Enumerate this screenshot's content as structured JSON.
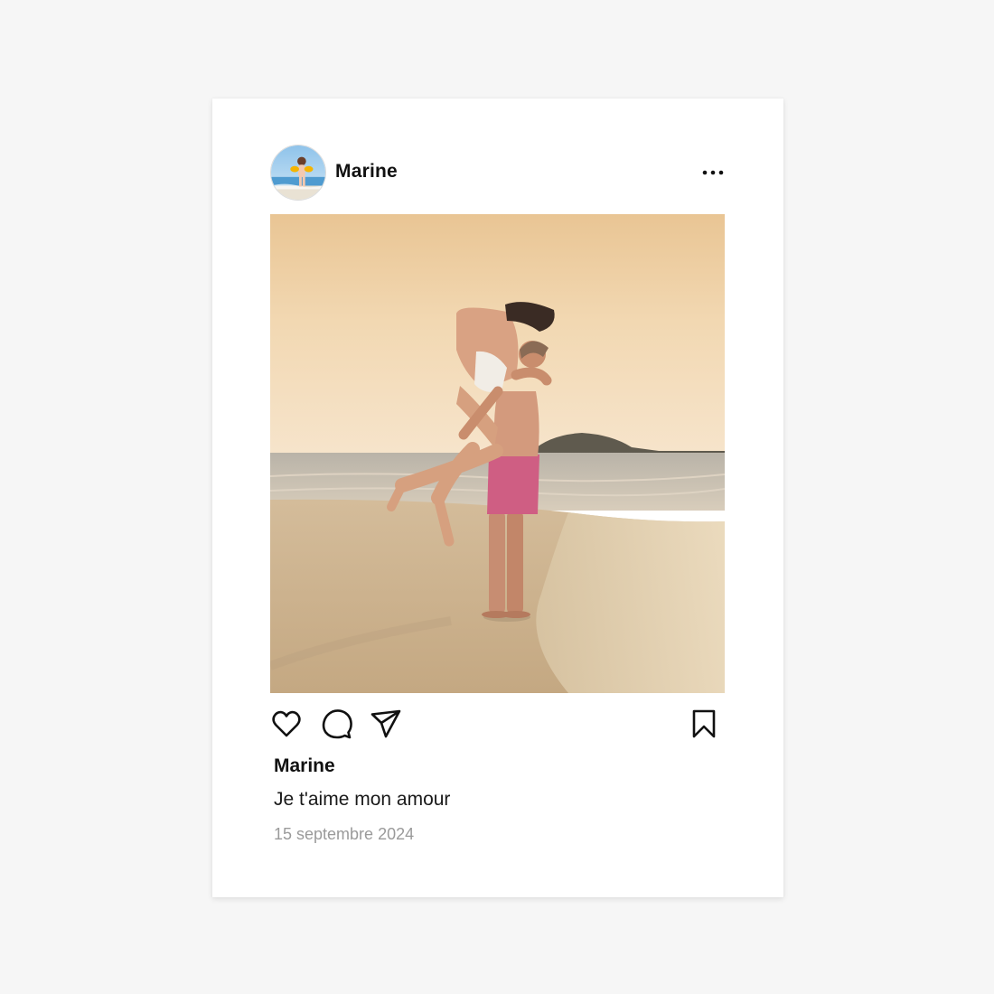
{
  "post": {
    "username": "Marine",
    "caption_username": "Marine",
    "caption": "Je t'aime mon amour",
    "date": "15 septembre 2024"
  },
  "icons": {
    "more": "more-horizontal-icon",
    "like": "heart-icon",
    "comment": "comment-icon",
    "share": "send-icon",
    "save": "bookmark-icon"
  },
  "colors": {
    "page_background": "#f6f6f6",
    "card_background": "#ffffff",
    "text_primary": "#111111",
    "text_muted": "#9a9a9a"
  }
}
